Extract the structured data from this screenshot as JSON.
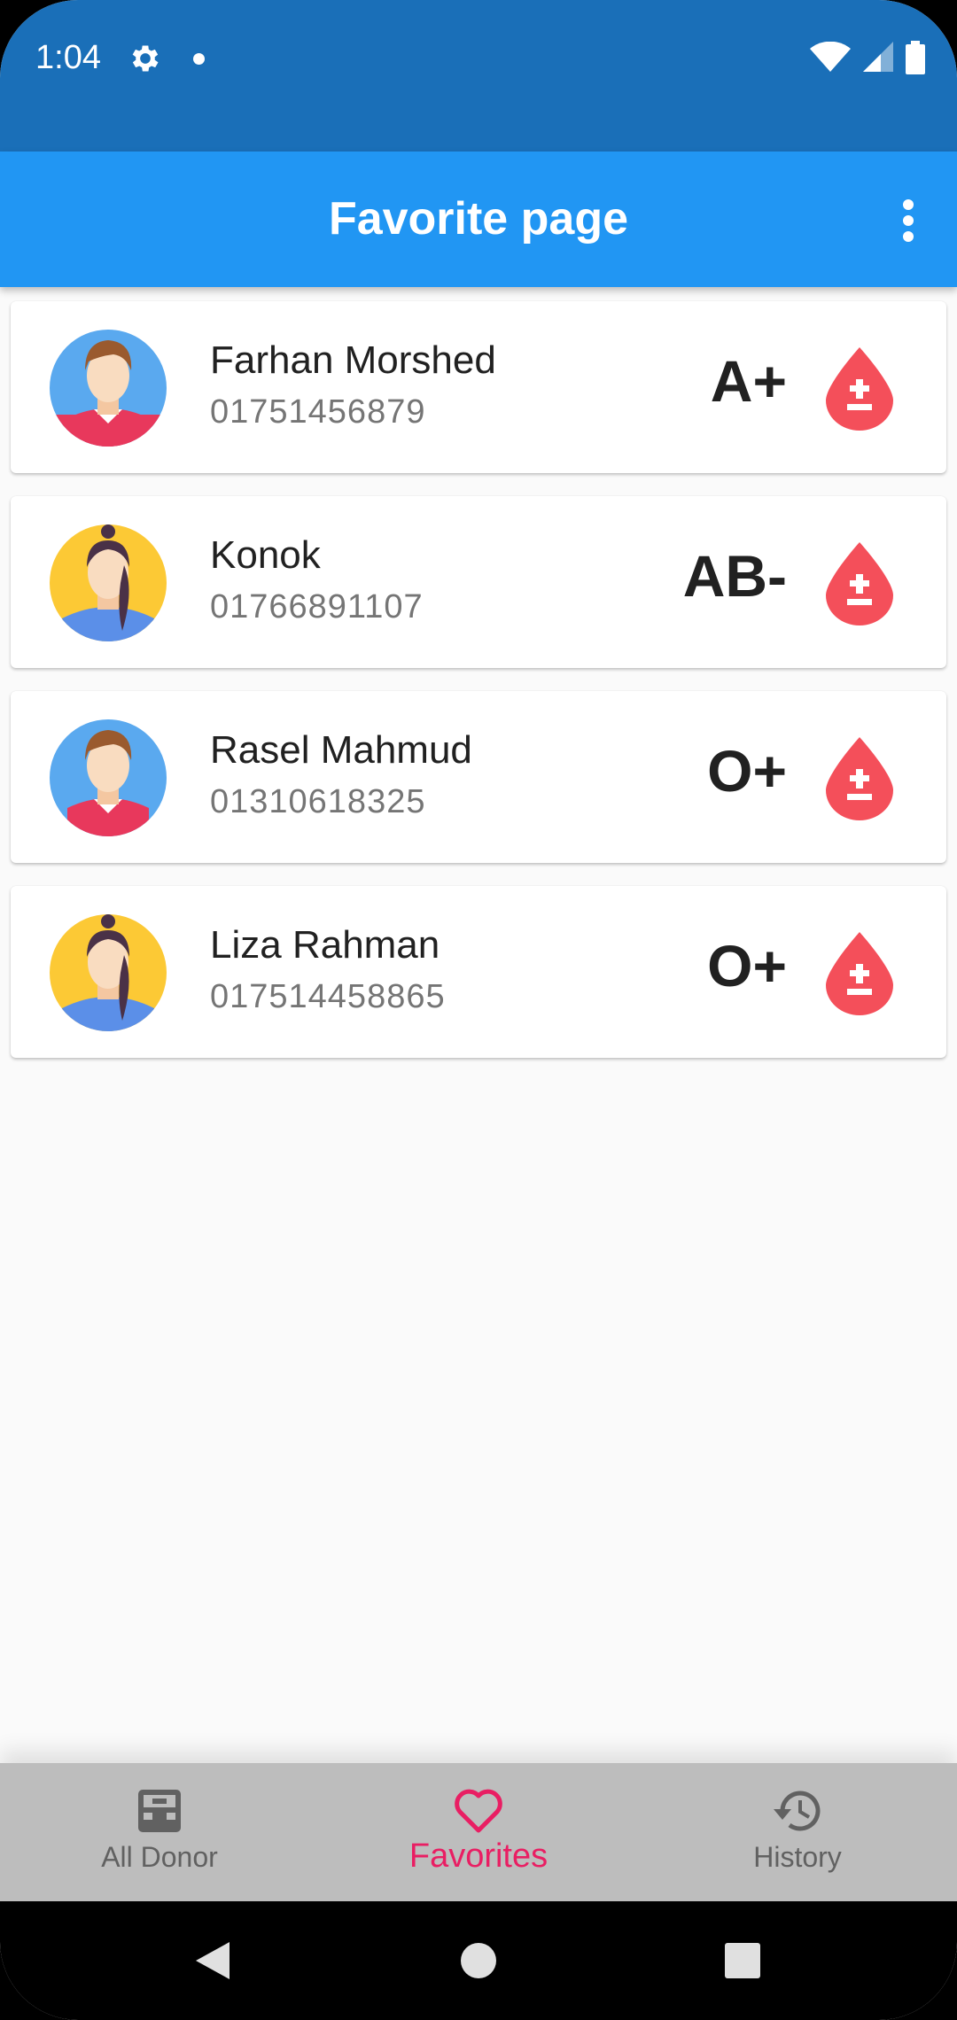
{
  "status_bar": {
    "time": "1:04",
    "icons": [
      "gear-icon",
      "notification-dot",
      "wifi-icon",
      "signal-icon",
      "battery-icon"
    ]
  },
  "app_bar": {
    "title": "Favorite page",
    "menu_icon": "more-vert-icon"
  },
  "donors": [
    {
      "name": "Farhan Morshed",
      "phone": "01751456879",
      "blood_group": "A+",
      "avatar": "male-avatar-icon"
    },
    {
      "name": "Konok",
      "phone": "01766891107",
      "blood_group": "AB-",
      "avatar": "female-avatar-icon"
    },
    {
      "name": "Rasel Mahmud",
      "phone": "01310618325",
      "blood_group": "O+",
      "avatar": "male-avatar-icon"
    },
    {
      "name": "Liza Rahman",
      "phone": "017514458865",
      "blood_group": "O+",
      "avatar": "female-avatar-icon"
    }
  ],
  "bottom_nav": {
    "items": [
      {
        "label": "All Donor",
        "icon": "inbox-icon",
        "active": false
      },
      {
        "label": "Favorites",
        "icon": "heart-outline-icon",
        "active": true
      },
      {
        "label": "History",
        "icon": "history-icon",
        "active": false
      }
    ],
    "active_color": "#e91e63"
  },
  "colors": {
    "status_bar": "#1a6fb8",
    "app_bar": "#2196f3",
    "blood_drop": "#f44f5a",
    "background": "#fafafa"
  }
}
